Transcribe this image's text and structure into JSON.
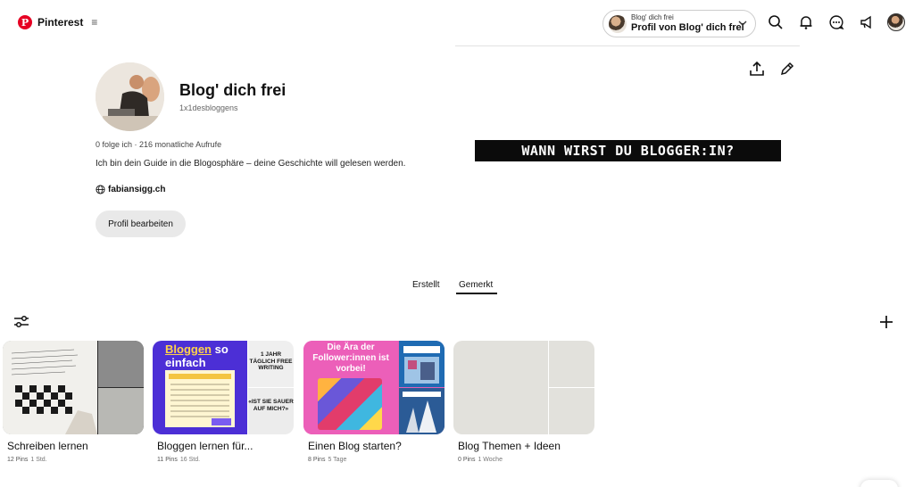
{
  "header": {
    "brand": "Pinterest",
    "menu_icon": "hamburger-icon",
    "account_switcher": {
      "small_label": "Blog' dich frei",
      "main_label": "Profil von Blog' dich frei"
    },
    "icons": [
      "search-icon",
      "bell-icon",
      "chat-icon",
      "megaphone-icon",
      "avatar",
      "chevron-down-icon"
    ]
  },
  "profile": {
    "name": "Blog' dich frei",
    "handle": "1x1desbloggens",
    "stats": "0 folge ich · 216 monatliche Aufrufe",
    "bio": "Ich bin dein Guide in die Blogosphäre – deine Geschichte will gelesen werden.",
    "website": "fabiansigg.ch",
    "edit_button": "Profil bearbeiten"
  },
  "cover": {
    "banner_text": "WANN WIRST DU BLOGGER:IN?"
  },
  "tabs": [
    {
      "label": "Erstellt",
      "active": false
    },
    {
      "label": "Gemerkt",
      "active": true
    }
  ],
  "boards": [
    {
      "title": "Schreiben lernen",
      "pins": "12 Pins",
      "time": "1 Std."
    },
    {
      "title": "Bloggen lernen für...",
      "pins": "11 Pins",
      "time": "16 Std.",
      "cover_text": {
        "headline_highlight": "Bloggen",
        "headline_rest": " so",
        "headline_line2": "einfach",
        "side_top": "1 JAHR TÄGLICH FREE WRITING",
        "side_bottom": "«IST SIE SAUER AUF MICH?»"
      }
    },
    {
      "title": "Einen Blog starten?",
      "pins": "8 Pins",
      "time": "5 Tage",
      "cover_text": {
        "headline": "Die Ära der Follower:innen ist vorbei!"
      }
    },
    {
      "title": "Blog Themen + Ideen",
      "pins": "0 Pins",
      "time": "1 Woche"
    }
  ],
  "colors": {
    "brand_red": "#e60023",
    "board2_purple": "#4c2fd6",
    "board3_pink": "#ec5fb9",
    "empty_board": "#e2e1dc"
  }
}
